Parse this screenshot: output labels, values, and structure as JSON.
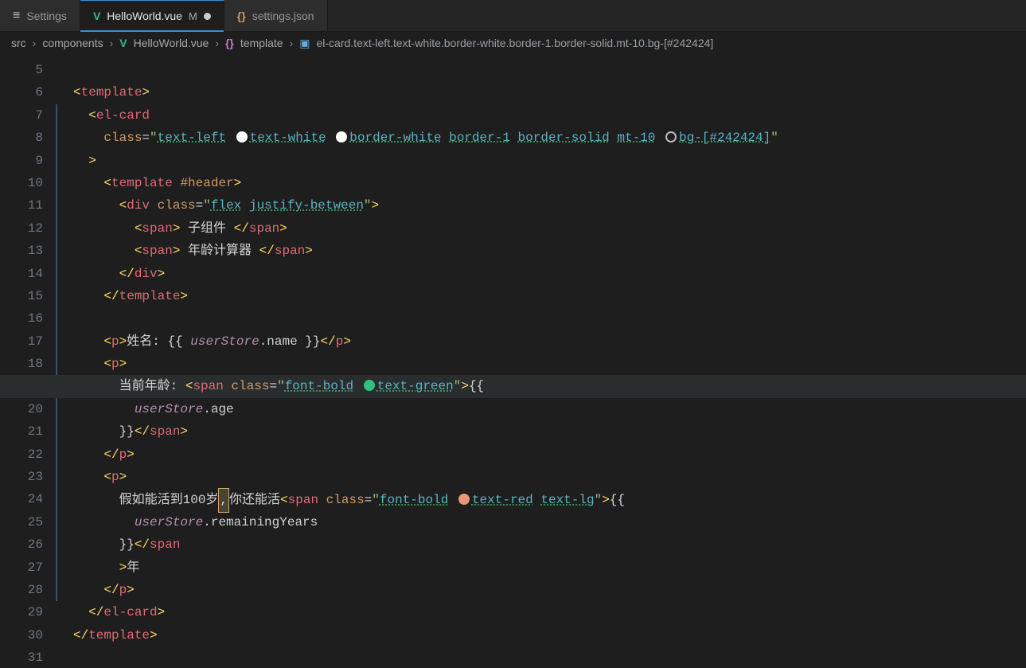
{
  "tabs": [
    {
      "icon": "menu",
      "label": "Settings",
      "modified": false,
      "active": false
    },
    {
      "icon": "vue",
      "label": "HelloWorld.vue",
      "badge": "M",
      "modified": true,
      "active": true
    },
    {
      "icon": "json",
      "label": "settings.json",
      "modified": false,
      "active": false
    }
  ],
  "breadcrumb": {
    "parts": [
      "src",
      "components",
      "HelloWorld.vue",
      "template"
    ],
    "last": "el-card.text-left.text-white.border-white.border-1.border-solid.mt-10.bg-[#242424]"
  },
  "gutter_start": 5,
  "gutter_end": 31,
  "code": {
    "classes_main": [
      "text-left",
      "text-white",
      "border-white",
      "border-1",
      "border-solid",
      "mt-10",
      "bg-[#242424]"
    ],
    "header_div_classes": [
      "flex",
      "justify-between"
    ],
    "span1": "子组件",
    "span2": "年龄计算器",
    "p1_label": "姓名: ",
    "p1_expr_obj": "userStore",
    "p1_expr_prop": ".name",
    "p2_label": "当前年龄: ",
    "p2_span_classes": [
      "font-bold",
      "text-green"
    ],
    "p2_expr_obj": "userStore",
    "p2_expr_prop": ".age",
    "p3_prefix": "假如能活到100岁",
    "p3_mid": "你还能活",
    "p3_boxed": ",",
    "p3_span_classes": [
      "font-bold",
      "text-red",
      "text-lg"
    ],
    "p3_expr_obj": "userStore",
    "p3_expr_prop": ".remainingYears",
    "p3_suffix": "年"
  }
}
